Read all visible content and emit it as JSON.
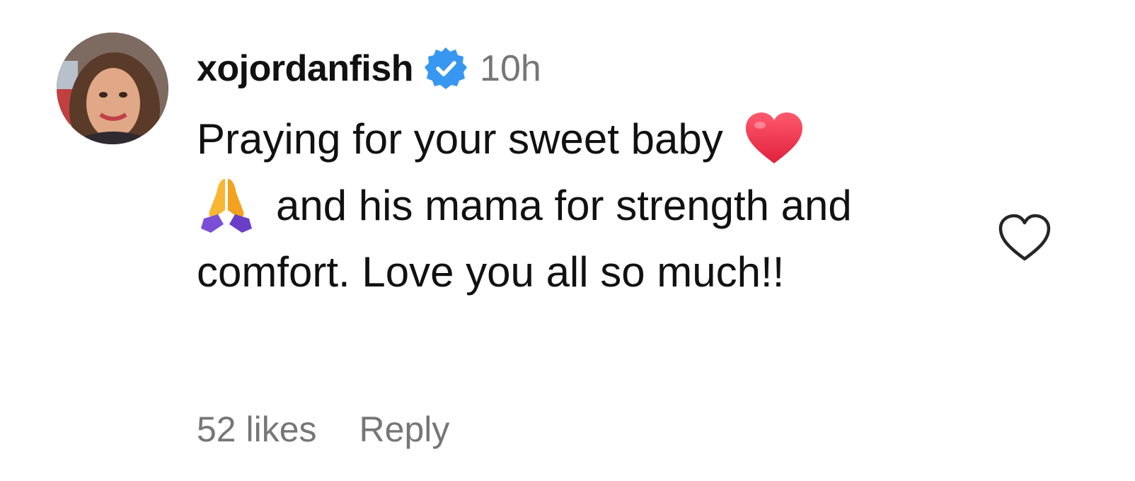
{
  "comment": {
    "username": "xojordanfish",
    "verified_icon": "verified-badge-icon",
    "timestamp": "10h",
    "text_part1": "Praying for your sweet baby",
    "text_part2": "and his mama for strength and comfort. Love you all so much!!",
    "emojis": [
      "red-heart-emoji",
      "folded-hands-emoji"
    ],
    "likes_label": "52 likes",
    "reply_label": "Reply",
    "like_icon": "heart-outline-icon"
  },
  "colors": {
    "verified_blue": "#3897f0",
    "meta_gray": "#767676",
    "text": "#111111"
  }
}
